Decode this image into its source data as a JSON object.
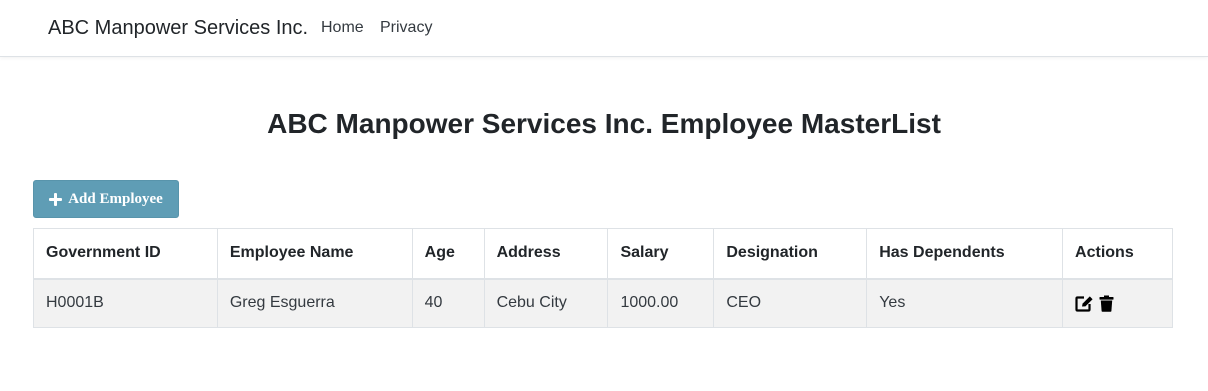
{
  "navbar": {
    "brand": "ABC Manpower Services Inc.",
    "links": [
      {
        "label": "Home"
      },
      {
        "label": "Privacy"
      }
    ]
  },
  "page": {
    "title": "ABC Manpower Services Inc. Employee MasterList",
    "add_button_label": "Add Employee",
    "add_button_icon": "plus-icon",
    "button_color": "#5f9db5"
  },
  "table": {
    "headers": [
      "Government ID",
      "Employee Name",
      "Age",
      "Address",
      "Salary",
      "Designation",
      "Has Dependents",
      "Actions"
    ],
    "rows": [
      {
        "government_id": "H0001B",
        "employee_name": "Greg Esguerra",
        "age": "40",
        "address": "Cebu City",
        "salary": "1000.00",
        "designation": "CEO",
        "has_dependents": "Yes",
        "actions": [
          "edit-icon",
          "trash-icon"
        ]
      }
    ]
  }
}
